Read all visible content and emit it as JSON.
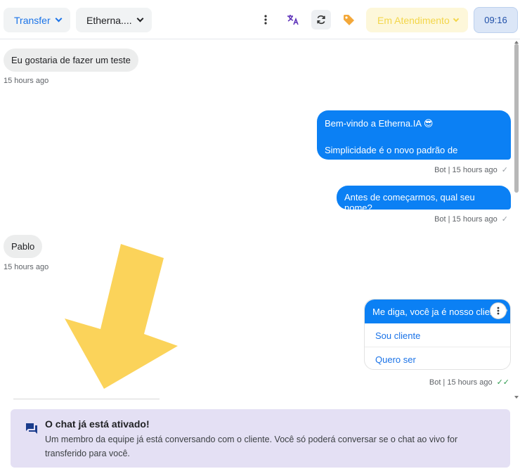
{
  "toolbar": {
    "transfer_label": "Transfer",
    "channel_label": "Etherna....",
    "status_label": "Em Atendimento",
    "time_label": "09:16",
    "icons": [
      "more-vert-icon",
      "translate-icon",
      "refresh-icon",
      "tag-icon"
    ]
  },
  "messages": {
    "m1_text": "Eu gostaria de fazer um teste",
    "m1_time": "15 hours ago",
    "m2_line1": "Bem-vindo a Etherna.IA 😎",
    "m2_line2": "Simplicidade é o novo padrão de excelência!",
    "m2_meta": "Bot | 15 hours ago",
    "m3_text": "Antes de começarmos, qual seu nome?",
    "m3_meta": "Bot | 15 hours ago",
    "m4_text": "Pablo",
    "m4_time": "15 hours ago",
    "m5_text": "Me diga, você ja é nosso cliente?",
    "m5_options": [
      "Sou cliente",
      "Quero ser"
    ],
    "m5_meta": "Bot | 15 hours ago"
  },
  "notice": {
    "title": "O chat já está ativado!",
    "body": "Um membro da equipe já está conversando com o cliente. Você só poderá conversar se o chat ao vivo for transferido para você."
  },
  "colors": {
    "accent": "#1a73e8",
    "bubble_out": "#0b80f4",
    "bubble_in": "#eceded",
    "status": "#f3d64a",
    "arrow": "#fbd35a",
    "notice_bg": "#e4e0f4"
  }
}
